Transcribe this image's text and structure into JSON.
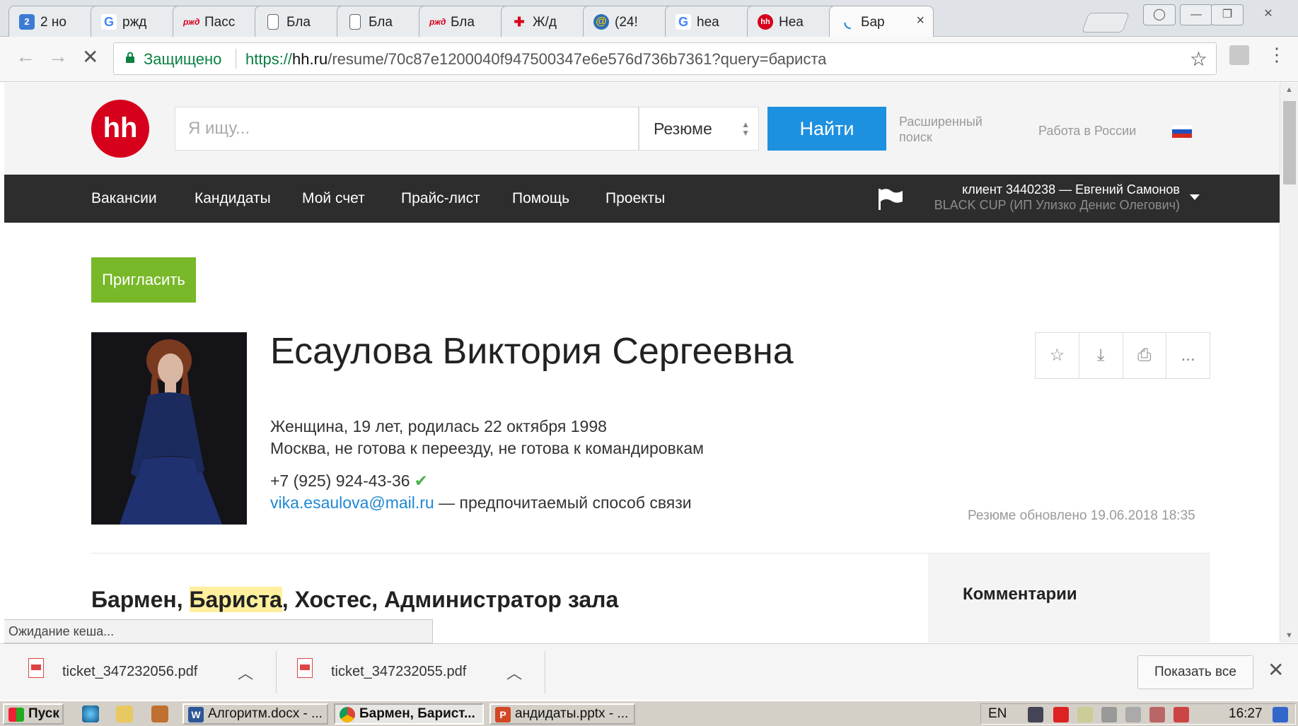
{
  "browser": {
    "tabs": [
      {
        "label": "2 но",
        "icon": "number-badge-icon",
        "badge": "2"
      },
      {
        "label": "ржд",
        "icon": "google-icon"
      },
      {
        "label": "Пасс",
        "icon": "rzd-icon"
      },
      {
        "label": "Бла",
        "icon": "document-icon"
      },
      {
        "label": "Бла",
        "icon": "document-icon"
      },
      {
        "label": "Бла",
        "icon": "rzd-icon"
      },
      {
        "label": "Ж/д",
        "icon": "railway-icon"
      },
      {
        "label": "(24!",
        "icon": "mail-at-icon"
      },
      {
        "label": "hea",
        "icon": "google-icon"
      },
      {
        "label": "Hea",
        "icon": "hh-icon"
      },
      {
        "label": "Бар",
        "icon": "loading-icon",
        "active": true
      }
    ],
    "address": {
      "secure_label": "Защищено",
      "url_proto": "https://",
      "url_host": "hh.ru",
      "url_path": "/resume/70c87e1200040f947500347e6e576d736b7361?query=бариста"
    },
    "status_text": "Ожидание кеша..."
  },
  "header": {
    "logo": "hh",
    "search_placeholder": "Я ищу...",
    "search_type": "Резюме",
    "find_label": "Найти",
    "advanced_line1": "Расширенный",
    "advanced_line2": "поиск",
    "region_label": "Работа в России"
  },
  "nav": {
    "items": [
      "Вакансии",
      "Кандидаты",
      "Мой счет",
      "Прайс-лист",
      "Помощь",
      "Проекты"
    ],
    "client_line": "клиент 3440238 — Евгений Самонов",
    "company_line": "BLACK CUP (ИП Улизко Денис Олегович)"
  },
  "resume": {
    "invite_label": "Пригласить",
    "name": "Есаулова Виктория Сергеевна",
    "details": "Женщина, 19 лет, родилась 22 октября 1998",
    "location": "Москва, не готова к переезду, не готова к командировкам",
    "phone": "+7 (925) 924-43-36",
    "email": "vika.esaulova@mail.ru",
    "email_note": " — предпочитаемый способ связи",
    "updated": "Резюме обновлено 19.06.2018 18:35",
    "position_before": "Бармен, ",
    "position_highlight": "Бариста",
    "position_after": ", Хостес, Администратор зала",
    "comments_title": "Комментарии",
    "action_more": "..."
  },
  "downloads": {
    "files": [
      "ticket_347232056.pdf",
      "ticket_347232055.pdf"
    ],
    "show_all": "Показать все"
  },
  "taskbar": {
    "start": "Пуск",
    "tasks": [
      {
        "label": "Алгоритм.docx - ...",
        "icon": "word-icon"
      },
      {
        "label": "Бармен, Барист...",
        "icon": "chrome-icon",
        "active": true
      },
      {
        "label": "андидаты.pptx - ...",
        "icon": "powerpoint-icon"
      }
    ],
    "lang": "EN",
    "clock": "16:27"
  },
  "colors": {
    "hh_red": "#d6001c",
    "find_blue": "#1e90e0",
    "invite_green": "#78b829",
    "nav_dark": "#2d2d2d",
    "link_blue": "#1e88d3",
    "highlight": "#ffef9e"
  }
}
